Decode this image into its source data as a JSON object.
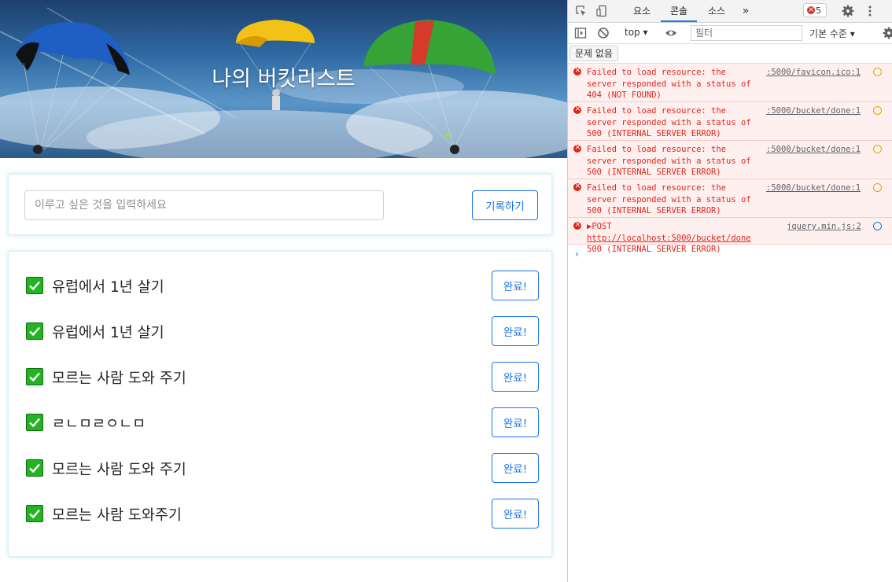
{
  "page": {
    "hero_title": "나의 버킷리스트",
    "input": {
      "placeholder": "이루고 싶은 것을 입력하세요",
      "value": ""
    },
    "record_button": "기록하기",
    "done_label": "완료!",
    "items": [
      {
        "text": "유럽에서 1년 살기",
        "checked": true
      },
      {
        "text": "유럽에서 1년 살기",
        "checked": true
      },
      {
        "text": "모르는 사람 도와 주기",
        "checked": true
      },
      {
        "text": "ㄹㄴㅁㄹㅇㄴㅁ",
        "checked": true
      },
      {
        "text": "모르는 사람 도와 주기",
        "checked": true
      },
      {
        "text": "모르는 사람 도와주기",
        "checked": true
      }
    ],
    "colors": {
      "check_green": "#23b323",
      "button_blue": "#1a73e8"
    }
  },
  "devtools": {
    "tabs": [
      "요소",
      "콘솔",
      "소스"
    ],
    "active_tab": "콘솔",
    "more_tabs": "»",
    "error_count": "5",
    "context": "top ▾",
    "filter_placeholder": "필터",
    "level": "기본 수준 ▾",
    "issues": "문제 없음",
    "messages": [
      {
        "text": "Failed to load resource: the\nserver responded with a status of\n404 (NOT FOUND)",
        "source": ":5000/favicon.ico:1"
      },
      {
        "text": "Failed to load resource: the\nserver responded with a status of\n500 (INTERNAL SERVER ERROR)",
        "source": ":5000/bucket/done:1"
      },
      {
        "text": "Failed to load resource: the\nserver responded with a status of\n500 (INTERNAL SERVER ERROR)",
        "source": ":5000/bucket/done:1"
      },
      {
        "text": "Failed to load resource: the\nserver responded with a status of\n500 (INTERNAL SERVER ERROR)",
        "source": ":5000/bucket/done:1"
      }
    ],
    "post_message": {
      "prefix": "▶POST ",
      "url": "http://localhost:5000/bucket/done",
      "suffix": " 500 (INTERNAL SERVER ERROR)",
      "source": "jquery.min.js:2"
    },
    "prompt": "›"
  }
}
